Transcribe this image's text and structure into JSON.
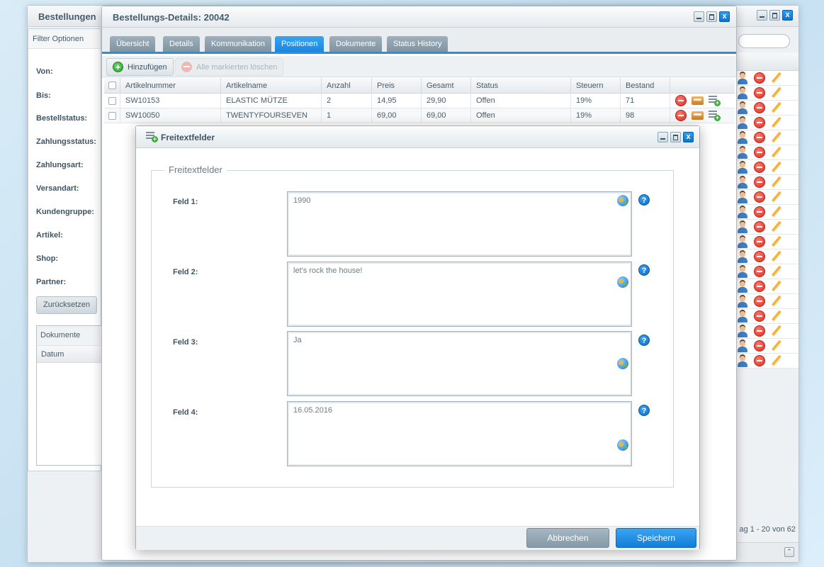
{
  "background_window": {
    "title": "Bestellungen",
    "filter_panel_title": "Filter Optionen",
    "filters": [
      "Von:",
      "Bis:",
      "Bestellstatus:",
      "Zahlungsstatus:",
      "Zahlungsart:",
      "Versandart:",
      "Kundengruppe:",
      "Artikel:",
      "Shop:",
      "Partner:"
    ],
    "reset_label": "Zurücksetzen",
    "documents_title": "Dokumente",
    "documents_column": "Datum",
    "paging_text": "ag 1 - 20 von 62",
    "row_icons": [
      "user-icon",
      "delete-icon",
      "pencil-icon"
    ]
  },
  "details_window": {
    "title": "Bestellungs-Details: 20042",
    "tabs": [
      "Übersicht",
      "Details",
      "Kommunikation",
      "Positionen",
      "Dokumente",
      "Status History"
    ],
    "active_tab": "Positionen",
    "toolbar": {
      "add_label": "Hinzufügen",
      "delete_marked_label": "Alle markierten löschen"
    },
    "grid": {
      "columns": [
        "Artikelnummer",
        "Artikelname",
        "Anzahl",
        "Preis",
        "Gesamt",
        "Status",
        "Steuern",
        "Bestand"
      ],
      "rows": [
        [
          "SW10153",
          "ELASTIC MÜTZE",
          "2",
          "14,95",
          "29,90",
          "Offen",
          "19%",
          "71"
        ],
        [
          "SW10050",
          "TWENTYFOURSEVEN",
          "1",
          "69,00",
          "69,00",
          "Offen",
          "19%",
          "98"
        ]
      ]
    }
  },
  "freitext_dialog": {
    "title": "Freitextfelder",
    "legend": "Freitextfelder",
    "fields": [
      {
        "label": "Feld 1:",
        "value": "1990"
      },
      {
        "label": "Feld 2:",
        "value": "let's rock the house!"
      },
      {
        "label": "Feld 3:",
        "value": "Ja"
      },
      {
        "label": "Feld 4:",
        "value": "16.05.2016"
      }
    ],
    "cancel_label": "Abbrechen",
    "save_label": "Speichern"
  },
  "colors": {
    "accent": "#2b8fe0",
    "tab_inactive": "#8fa2b0",
    "delete_red": "#d92d20",
    "add_green": "#3cae3c"
  }
}
